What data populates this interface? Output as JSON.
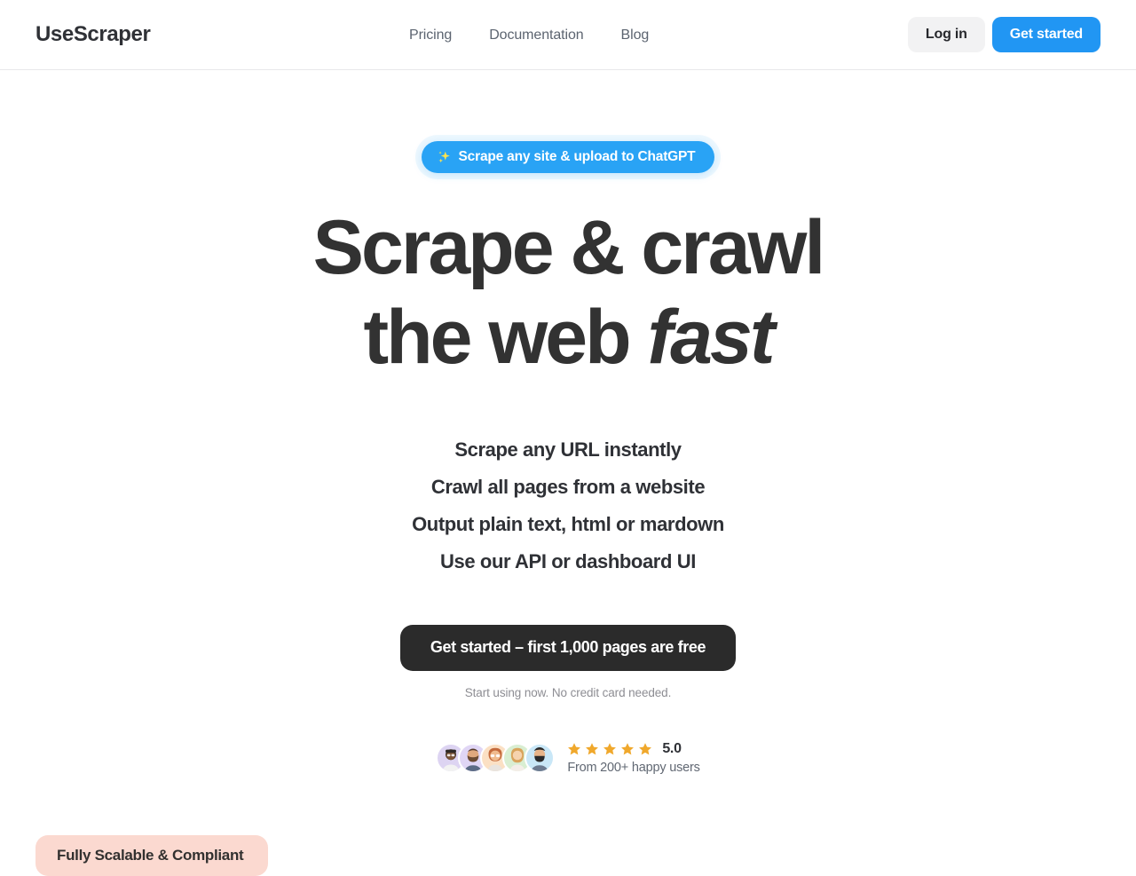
{
  "header": {
    "logo": "UseScraper",
    "nav": [
      {
        "label": "Pricing"
      },
      {
        "label": "Documentation"
      },
      {
        "label": "Blog"
      }
    ],
    "login_label": "Log in",
    "get_started_label": "Get started"
  },
  "hero": {
    "badge": {
      "text": "Scrape any site & upload to ChatGPT",
      "icon": "sparkles-icon",
      "background": "#29a3f5",
      "icon_color": "#ffe44d"
    },
    "title_line1": "Scrape & crawl",
    "title_line2_plain": "the web ",
    "title_line2_italic": "fast",
    "subheadings": [
      "Scrape any URL instantly",
      "Crawl all pages from a website",
      "Output plain text, html or mardown",
      "Use our API or dashboard UI"
    ],
    "cta_label": "Get started – first 1,000 pages are free",
    "cta_note": "Start using now. No credit card needed.",
    "cta_background": "#2b2b2b"
  },
  "social_proof": {
    "avatars": [
      {
        "name": "avatar-1",
        "background": "#ddd4f2"
      },
      {
        "name": "avatar-2",
        "background": "#e0d6f5"
      },
      {
        "name": "avatar-3",
        "background": "#fbe0c4"
      },
      {
        "name": "avatar-4",
        "background": "#d9eed2"
      },
      {
        "name": "avatar-5",
        "background": "#c9e7f7"
      }
    ],
    "star_count": 5,
    "star_color": "#f0a82c",
    "score": "5.0",
    "caption": "From 200+ happy users"
  },
  "bottom_section": {
    "pill_label": "Fully Scalable & Compliant",
    "pill_background": "#fbd9d0"
  }
}
